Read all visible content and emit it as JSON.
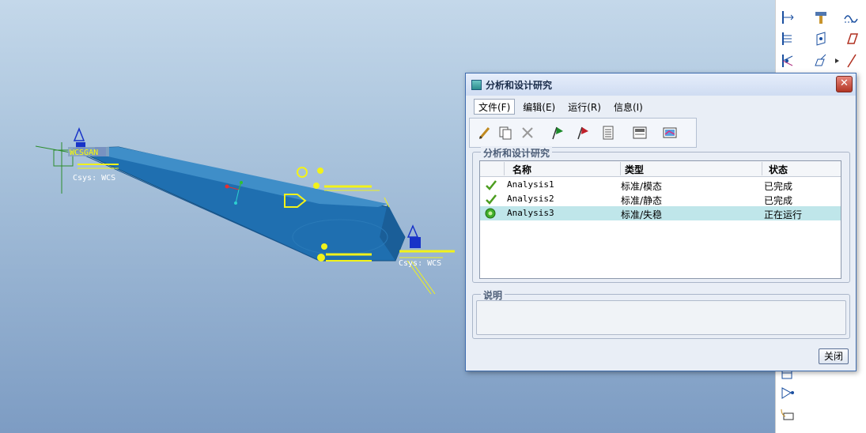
{
  "viewport": {
    "model_labels": {
      "wcs_top": "WCSGAN",
      "csys_left": "Csys: WCS",
      "csys_right": "Csys: WCS"
    }
  },
  "dialog": {
    "title": "分析和设计研究",
    "close_glyph": "✕",
    "menu": {
      "file": "文件(F)",
      "edit": "编辑(E)",
      "run": "运行(R)",
      "info": "信息(I)"
    },
    "toolbar_icons": [
      "pencil-icon",
      "copy-icon",
      "delete-icon",
      "green-flag-icon",
      "red-flag-icon",
      "list-icon",
      "report-icon",
      "results-icon"
    ],
    "studies_group_label": "分析和设计研究",
    "table": {
      "columns": {
        "name": "名称",
        "type": "类型",
        "status": "状态"
      },
      "rows": [
        {
          "name": "Analysis1",
          "type": "标准/模态",
          "status": "已完成",
          "state": "done"
        },
        {
          "name": "Analysis2",
          "type": "标准/静态",
          "status": "已完成",
          "state": "done"
        },
        {
          "name": "Analysis3",
          "type": "标准/失稳",
          "status": "正在运行",
          "state": "running"
        }
      ]
    },
    "description_label": "说明",
    "description_text": "",
    "close_button": "关闭"
  },
  "colors": {
    "accent": "#3f6db0",
    "check_green": "#4c9d1f",
    "selected_row": "#bfe6ea",
    "model_blue": "#1f6fb0",
    "annotation_yellow": "#f2f21a"
  }
}
